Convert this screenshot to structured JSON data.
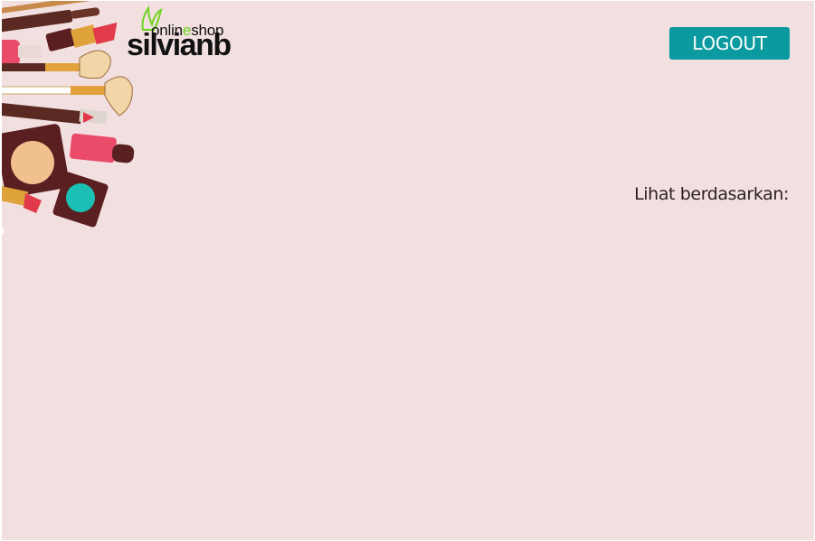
{
  "logo": {
    "top_prefix": "onlin",
    "top_accent": "e",
    "top_suffix": "shop",
    "main": "silvianb",
    "accent_color": "#6cd41c"
  },
  "header": {
    "logout_label": "LOGOUT",
    "button_color": "#0b9aa0"
  },
  "filter": {
    "label": "Lihat berdasarkan:"
  },
  "theme": {
    "background": "#f2e0e1"
  }
}
